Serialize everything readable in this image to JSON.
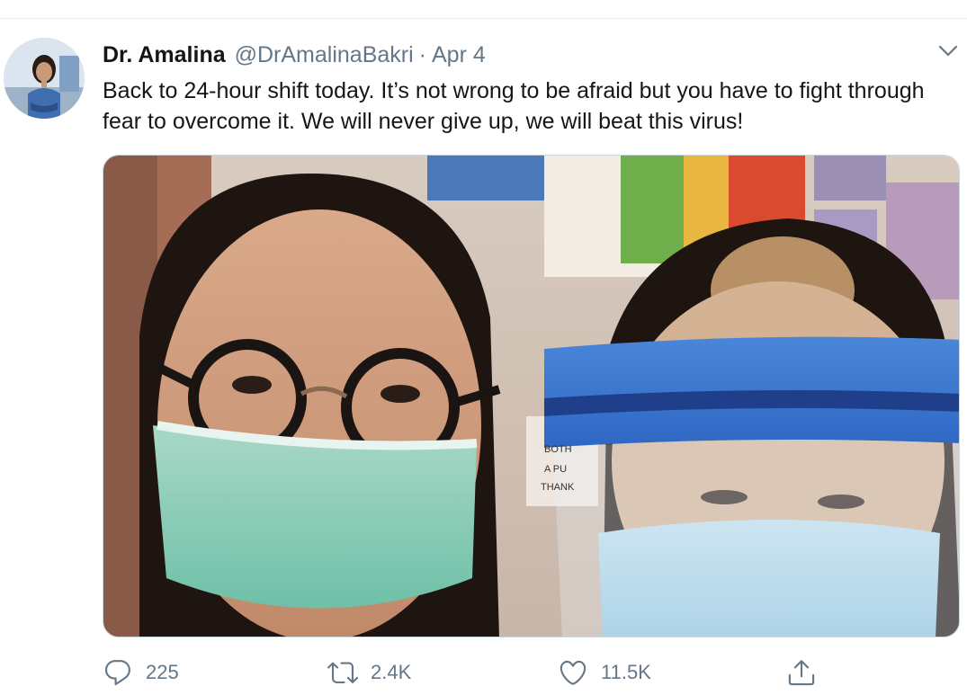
{
  "tweet": {
    "display_name": "Dr. Amalina",
    "handle": "@DrAmalinaBakri",
    "separator": "·",
    "date": "Apr 4",
    "text": "Back to 24-hour shift today. It’s not wrong to be afraid but you have to fight through fear to overcome it. We will never give up, we will beat this virus!",
    "media_description": "Selfie of two healthcare workers wearing surgical masks, one with glasses and one with a blue face shield, in front of a noticeboard",
    "media_sign_text": [
      "BOTH",
      "A PU",
      "THANK"
    ]
  },
  "actions": {
    "reply": {
      "icon": "reply-icon",
      "count": "225"
    },
    "retweet": {
      "icon": "retweet-icon",
      "count": "2.4K"
    },
    "like": {
      "icon": "heart-icon",
      "count": "11.5K"
    },
    "share": {
      "icon": "share-icon"
    }
  },
  "menu": {
    "icon": "chevron-down-icon"
  },
  "colors": {
    "text_primary": "#14171a",
    "text_secondary": "#657786",
    "divider": "#e6ecf0"
  }
}
